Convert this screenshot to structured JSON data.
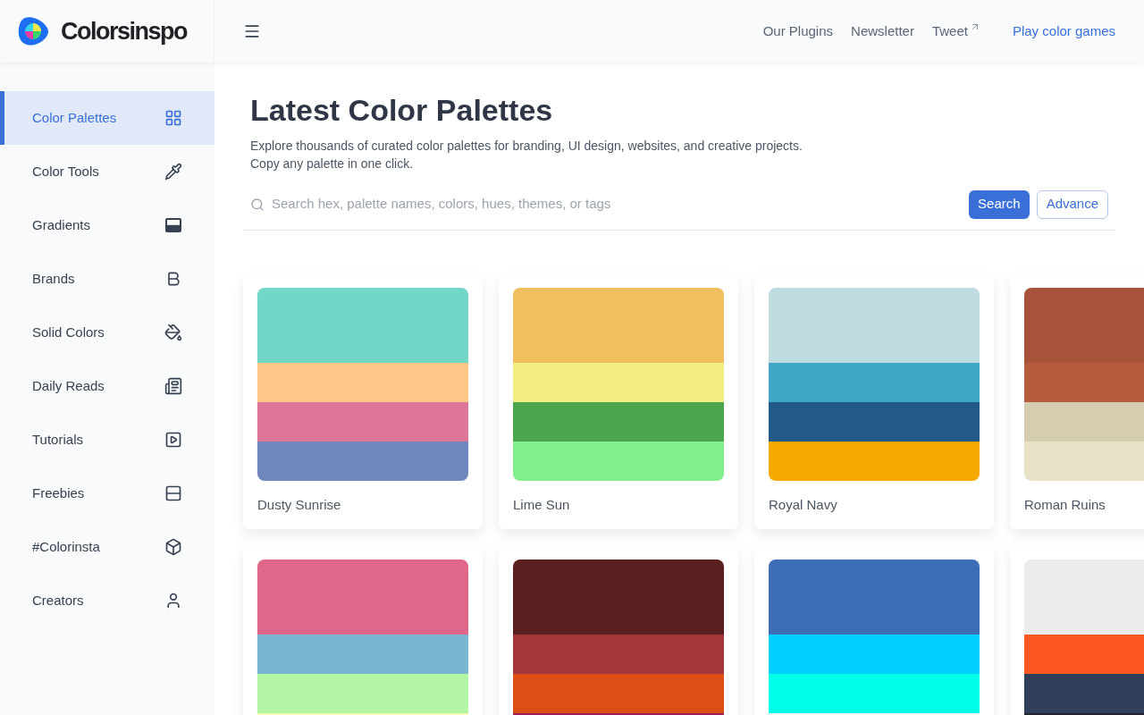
{
  "brand": {
    "name": "Colorsinspo"
  },
  "nav": {
    "links": [
      {
        "label": "Our Plugins",
        "external": false
      },
      {
        "label": "Newsletter",
        "external": false
      },
      {
        "label": "Tweet",
        "external": true
      }
    ],
    "cta": "Play color games"
  },
  "sidebar": {
    "items": [
      {
        "label": "Color Palettes",
        "selected": true
      },
      {
        "label": "Color Tools",
        "selected": false
      },
      {
        "label": "Gradients",
        "selected": false
      },
      {
        "label": "Brands",
        "selected": false
      },
      {
        "label": "Solid Colors",
        "selected": false
      },
      {
        "label": "Daily Reads",
        "selected": false
      },
      {
        "label": "Tutorials",
        "selected": false
      },
      {
        "label": "Freebies",
        "selected": false
      },
      {
        "label": "#Colorinsta",
        "selected": false
      },
      {
        "label": "Creators",
        "selected": false
      }
    ]
  },
  "page": {
    "title": "Latest Color Palettes",
    "description": "Explore thousands of curated color palettes for branding, UI design, websites, and creative projects.\nCopy any palette in one click."
  },
  "search": {
    "placeholder": "Search hex, palette names, colors, hues, themes, or tags",
    "buttons": [
      "Search",
      "Advance"
    ]
  },
  "palettes": [
    {
      "name": "Dusty Sunrise",
      "swatches": [
        {
          "color": "#73d7c8"
        },
        {
          "color": "#ffc788"
        },
        {
          "color": "#df7598"
        },
        {
          "color": "#7087bd"
        }
      ]
    },
    {
      "name": "Lime Sun",
      "swatches": [
        {
          "color": "#efc05d"
        },
        {
          "color": "#f2ed82"
        },
        {
          "color": "#4ca64e"
        },
        {
          "color": "#82ef8e"
        }
      ]
    },
    {
      "name": "Royal Navy",
      "swatches": [
        {
          "color": "#bedcdf"
        },
        {
          "color": "#40a6c6"
        },
        {
          "color": "#235987"
        },
        {
          "color": "#f6aa00"
        }
      ]
    },
    {
      "name": "Roman Ruins",
      "swatches": [
        {
          "color": "#a6533a"
        },
        {
          "color": "#b55b3e"
        },
        {
          "color": "#d5cdb0"
        },
        {
          "color": "#e8e3c8"
        }
      ]
    },
    {
      "swatches": [
        {
          "color": "#e0678a"
        },
        {
          "color": "#7bb6d0"
        },
        {
          "color": "#b2f5a4"
        },
        {
          "color": "#fffcb5"
        }
      ]
    },
    {
      "swatches": [
        {
          "color": "#5a1f1f"
        },
        {
          "color": "#a3363a"
        },
        {
          "color": "#dd4e17"
        },
        {
          "color": "#9a205c"
        }
      ]
    },
    {
      "swatches": [
        {
          "color": "#3d6db7"
        },
        {
          "color": "#00cfff"
        },
        {
          "color": "#00ffe8"
        },
        {
          "color": "#f7f8f4"
        }
      ]
    },
    {
      "swatches": [
        {
          "color": "#ececec"
        },
        {
          "color": "#ff5722"
        },
        {
          "color": "#2f3f5a"
        },
        {
          "color": "#22252e"
        }
      ]
    }
  ]
}
